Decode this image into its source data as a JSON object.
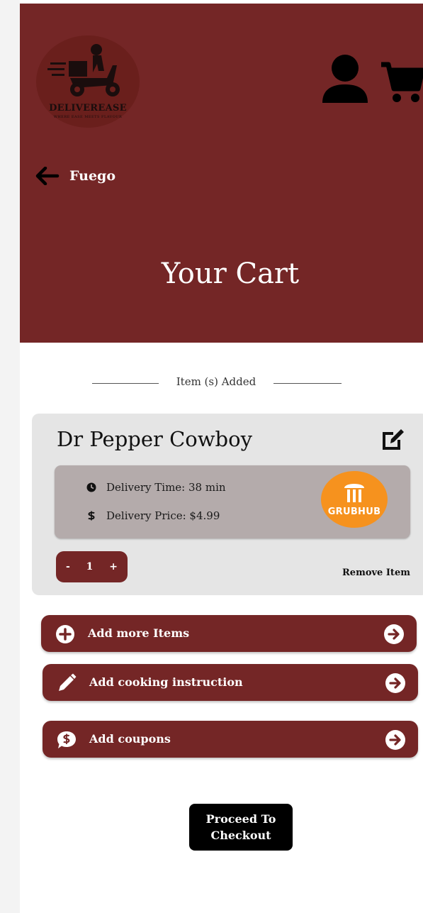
{
  "brand": {
    "logo_text": "DELIVEREASE",
    "logo_tagline": "WHERE EASE MEETS FLAVOUR",
    "header_color": "#742626"
  },
  "header": {
    "back_label": "Fuego",
    "page_title": "Your Cart",
    "icons": [
      "user-icon",
      "shopping-cart-icon",
      "arrow-left-icon"
    ]
  },
  "items_section": {
    "divider_label": "Item (s) Added"
  },
  "cart_item": {
    "name": "Dr Pepper Cowboy",
    "delivery_time": "Delivery Time: 38 min",
    "delivery_price": "Delivery Price: $4.99",
    "provider_label": "GRUBHUB",
    "provider_color": "#f6921e",
    "quantity": {
      "minus": "-",
      "value": "1",
      "plus": "+"
    },
    "remove_label": "Remove Item"
  },
  "actions": [
    {
      "label": "Add more Items",
      "icon": "plus-circle-icon"
    },
    {
      "label": "Add cooking instruction",
      "icon": "pencil-icon"
    },
    {
      "label": "Add coupons",
      "icon": "coupon-dollar-icon"
    }
  ],
  "checkout": {
    "line1": "Proceed To",
    "line2": "Checkout"
  }
}
